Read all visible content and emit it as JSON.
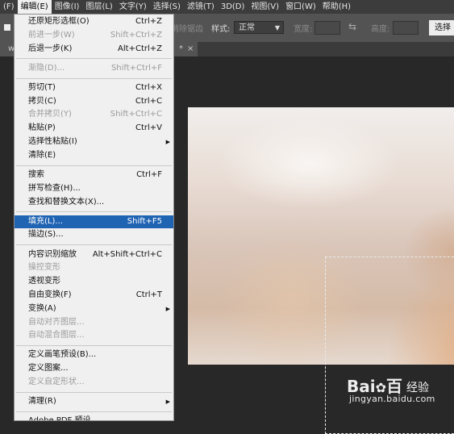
{
  "menubar": [
    {
      "label": "(F)",
      "active": false
    },
    {
      "label": "编辑(E)",
      "active": true
    },
    {
      "label": "图像(I)",
      "active": false
    },
    {
      "label": "图层(L)",
      "active": false
    },
    {
      "label": "文字(Y)",
      "active": false
    },
    {
      "label": "选择(S)",
      "active": false
    },
    {
      "label": "滤镜(T)",
      "active": false
    },
    {
      "label": "3D(D)",
      "active": false
    },
    {
      "label": "视图(V)",
      "active": false
    },
    {
      "label": "窗口(W)",
      "active": false
    },
    {
      "label": "帮助(H)",
      "active": false
    }
  ],
  "options": {
    "faded_label": "消除锯齿",
    "style_label": "样式:",
    "style_value": "正常",
    "width_label": "宽度:",
    "height_label": "高度:",
    "select_button": "选择"
  },
  "tab": {
    "left_text": "w",
    "right_text": "*",
    "close": "×"
  },
  "edit_menu": {
    "groups": [
      [
        {
          "label": "还原矩形选框(O)",
          "shortcut": "Ctrl+Z",
          "disabled": false
        },
        {
          "label": "前进一步(W)",
          "shortcut": "Shift+Ctrl+Z",
          "disabled": true
        },
        {
          "label": "后退一步(K)",
          "shortcut": "Alt+Ctrl+Z",
          "disabled": false
        }
      ],
      [
        {
          "label": "渐隐(D)...",
          "shortcut": "Shift+Ctrl+F",
          "disabled": true
        }
      ],
      [
        {
          "label": "剪切(T)",
          "shortcut": "Ctrl+X",
          "disabled": false
        },
        {
          "label": "拷贝(C)",
          "shortcut": "Ctrl+C",
          "disabled": false
        },
        {
          "label": "合并拷贝(Y)",
          "shortcut": "Shift+Ctrl+C",
          "disabled": true
        },
        {
          "label": "粘贴(P)",
          "shortcut": "Ctrl+V",
          "disabled": false
        },
        {
          "label": "选择性粘贴(I)",
          "shortcut": "",
          "disabled": false,
          "submenu": true
        },
        {
          "label": "清除(E)",
          "shortcut": "",
          "disabled": false
        }
      ],
      [
        {
          "label": "搜索",
          "shortcut": "Ctrl+F",
          "disabled": false
        },
        {
          "label": "拼写检查(H)...",
          "shortcut": "",
          "disabled": false
        },
        {
          "label": "查找和替换文本(X)...",
          "shortcut": "",
          "disabled": false
        }
      ],
      [
        {
          "label": "填充(L)...",
          "shortcut": "Shift+F5",
          "disabled": false,
          "highlighted": true
        },
        {
          "label": "描边(S)...",
          "shortcut": "",
          "disabled": false
        }
      ],
      [
        {
          "label": "内容识别缩放",
          "shortcut": "Alt+Shift+Ctrl+C",
          "disabled": false
        },
        {
          "label": "操控变形",
          "shortcut": "",
          "disabled": true
        },
        {
          "label": "透视变形",
          "shortcut": "",
          "disabled": false
        },
        {
          "label": "自由变换(F)",
          "shortcut": "Ctrl+T",
          "disabled": false
        },
        {
          "label": "变换(A)",
          "shortcut": "",
          "disabled": false,
          "submenu": true
        },
        {
          "label": "自动对齐图层...",
          "shortcut": "",
          "disabled": true
        },
        {
          "label": "自动混合图层...",
          "shortcut": "",
          "disabled": true
        }
      ],
      [
        {
          "label": "定义画笔预设(B)...",
          "shortcut": "",
          "disabled": false
        },
        {
          "label": "定义图案...",
          "shortcut": "",
          "disabled": false
        },
        {
          "label": "定义自定形状...",
          "shortcut": "",
          "disabled": true
        }
      ],
      [
        {
          "label": "清理(R)",
          "shortcut": "",
          "disabled": false,
          "submenu": true
        }
      ],
      [
        {
          "label": "Adobe PDF 预设...",
          "shortcut": "",
          "disabled": false
        }
      ]
    ]
  },
  "watermark": {
    "brand": "Bai",
    "brand2": "百",
    "site": "经验",
    "url": "jingyan.baidu.com"
  }
}
